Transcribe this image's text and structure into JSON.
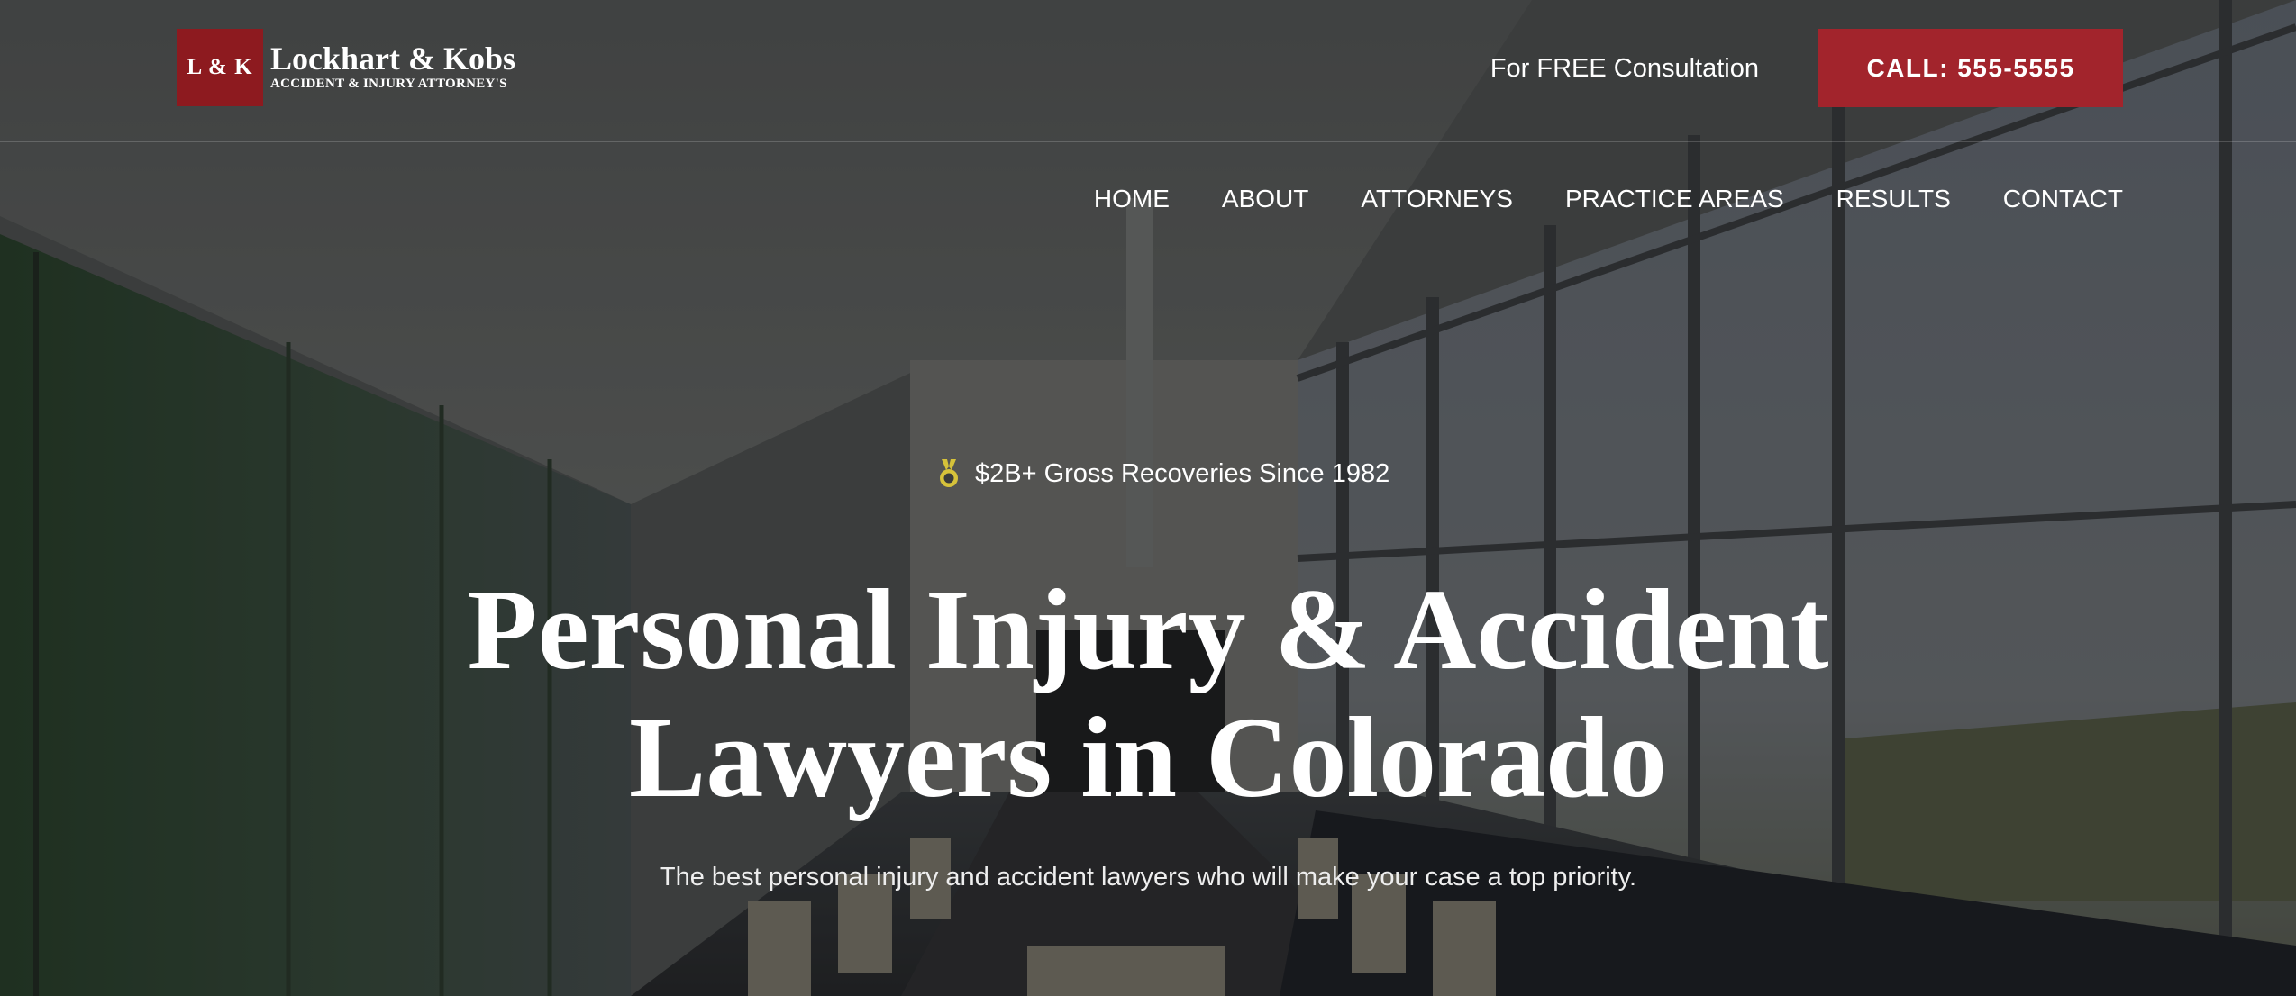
{
  "brand": {
    "mark": "L & K",
    "name": "Lockhart & Kobs",
    "tagline": "ACCIDENT & INJURY ATTORNEY'S",
    "color": "#8d1a1f"
  },
  "header": {
    "consultation_text": "For FREE Consultation",
    "call_button_label": "CALL: 555-5555",
    "call_button_color": "#a2242c"
  },
  "nav": {
    "items": [
      {
        "label": "HOME"
      },
      {
        "label": "ABOUT"
      },
      {
        "label": "ATTORNEYS"
      },
      {
        "label": "PRACTICE AREAS"
      },
      {
        "label": "RESULTS"
      },
      {
        "label": "CONTACT"
      }
    ]
  },
  "hero": {
    "badge_icon": "medal-icon",
    "badge_color": "#d6c23a",
    "badge_text": "$2B+ Gross Recoveries Since 1982",
    "headline_line1": "Personal Injury & Accident",
    "headline_line2": "Lawyers in Colorado",
    "subheadline": "The best personal injury and accident lawyers who will make your case a top priority."
  }
}
